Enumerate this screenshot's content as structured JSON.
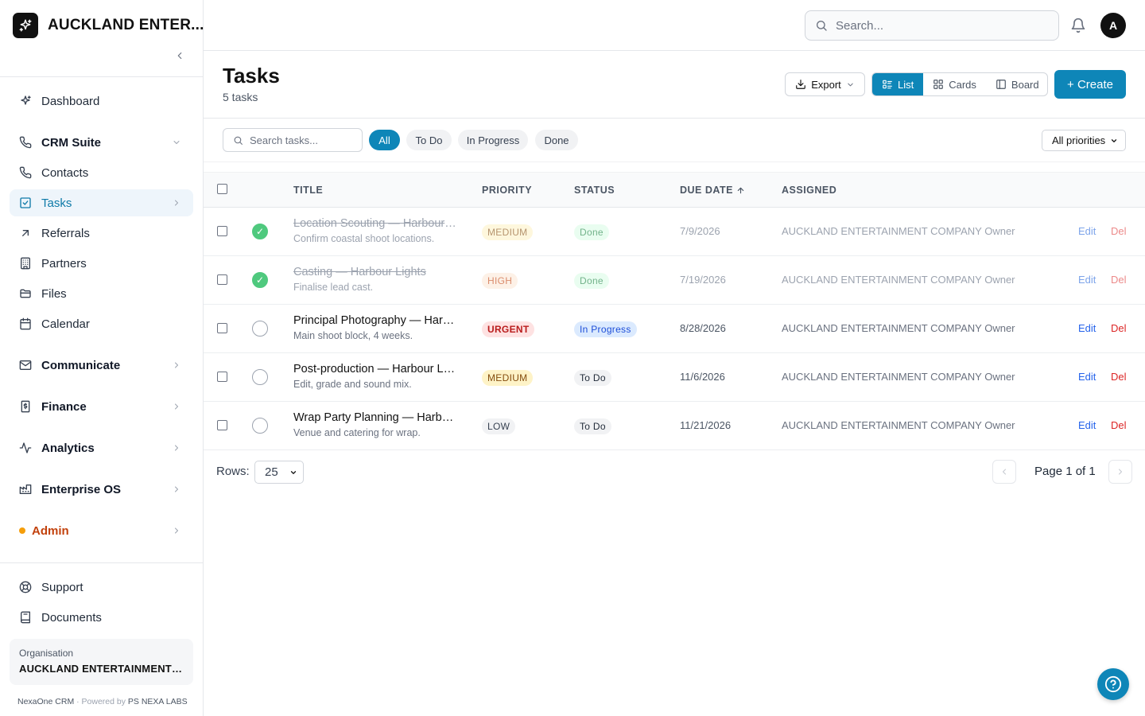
{
  "brand": {
    "name": "AUCKLAND ENTER..."
  },
  "sidebar": {
    "items": [
      {
        "label": "Dashboard",
        "icon": "sparkle-icon"
      },
      {
        "label": "CRM Suite",
        "icon": "phone-icon"
      },
      {
        "label": "Contacts",
        "icon": "phone-icon"
      },
      {
        "label": "Tasks",
        "icon": "checkbox-icon"
      },
      {
        "label": "Referrals",
        "icon": "arrow-up-right-icon"
      },
      {
        "label": "Partners",
        "icon": "building-icon"
      },
      {
        "label": "Files",
        "icon": "folder-icon"
      },
      {
        "label": "Calendar",
        "icon": "calendar-icon"
      },
      {
        "label": "Communicate",
        "icon": "mail-icon"
      },
      {
        "label": "Finance",
        "icon": "receipt-icon"
      },
      {
        "label": "Analytics",
        "icon": "activity-icon"
      },
      {
        "label": "Enterprise OS",
        "icon": "factory-icon"
      },
      {
        "label": "Admin",
        "icon": "status-dot-icon"
      },
      {
        "label": "Support",
        "icon": "lifebuoy-icon"
      },
      {
        "label": "Documents",
        "icon": "book-icon"
      }
    ],
    "organisation_label": "Organisation",
    "organisation_name": "AUCKLAND ENTERTAINMENT CO...",
    "footer_app": "NexaOne CRM",
    "footer_sep": " · Powered by ",
    "footer_company": "PS NEXA LABS"
  },
  "topbar": {
    "search_placeholder": "Search...",
    "avatar_initial": "A"
  },
  "header": {
    "title": "Tasks",
    "count": "5 tasks",
    "export_label": "Export",
    "views": [
      "List",
      "Cards",
      "Board"
    ],
    "active_view": "List",
    "create_label": "+ Create"
  },
  "filters": {
    "search_placeholder": "Search tasks...",
    "chips": [
      "All",
      "To Do",
      "In Progress",
      "Done"
    ],
    "active_chip": "All",
    "priority_select": "All priorities"
  },
  "table": {
    "columns": [
      "TITLE",
      "PRIORITY",
      "STATUS",
      "DUE DATE",
      "ASSIGNED"
    ],
    "sort_column": "DUE DATE",
    "sort_direction": "ascending",
    "rows": [
      {
        "title": "Location Scouting — Harbour Lights",
        "description": "Confirm coastal shoot locations.",
        "priority": "MEDIUM",
        "status": "Done",
        "due": "7/9/2026",
        "assigned": "AUCKLAND ENTERTAINMENT COMPANY Owner",
        "edit": "Edit",
        "del": "Del",
        "completed": true
      },
      {
        "title": "Casting — Harbour Lights",
        "description": "Finalise lead cast.",
        "priority": "HIGH",
        "status": "Done",
        "due": "7/19/2026",
        "assigned": "AUCKLAND ENTERTAINMENT COMPANY Owner",
        "edit": "Edit",
        "del": "Del",
        "completed": true
      },
      {
        "title": "Principal Photography — Harbour Lights",
        "description": "Main shoot block, 4 weeks.",
        "priority": "URGENT",
        "status": "In Progress",
        "due": "8/28/2026",
        "assigned": "AUCKLAND ENTERTAINMENT COMPANY Owner",
        "edit": "Edit",
        "del": "Del",
        "completed": false
      },
      {
        "title": "Post-production — Harbour Lights",
        "description": "Edit, grade and sound mix.",
        "priority": "MEDIUM",
        "status": "To Do",
        "due": "11/6/2026",
        "assigned": "AUCKLAND ENTERTAINMENT COMPANY Owner",
        "edit": "Edit",
        "del": "Del",
        "completed": false
      },
      {
        "title": "Wrap Party Planning — Harbour Lights",
        "description": "Venue and catering for wrap.",
        "priority": "LOW",
        "status": "To Do",
        "due": "11/21/2026",
        "assigned": "AUCKLAND ENTERTAINMENT COMPANY Owner",
        "edit": "Edit",
        "del": "Del",
        "completed": false
      }
    ]
  },
  "pagination": {
    "rows_label": "Rows:",
    "rows_value": "25",
    "page_info": "Page 1 of 1"
  },
  "colors": {
    "accent": "#0e86b8",
    "active_nav_bg": "#eef5fb",
    "admin": "#c2410c",
    "done_check": "#4fc97e"
  }
}
